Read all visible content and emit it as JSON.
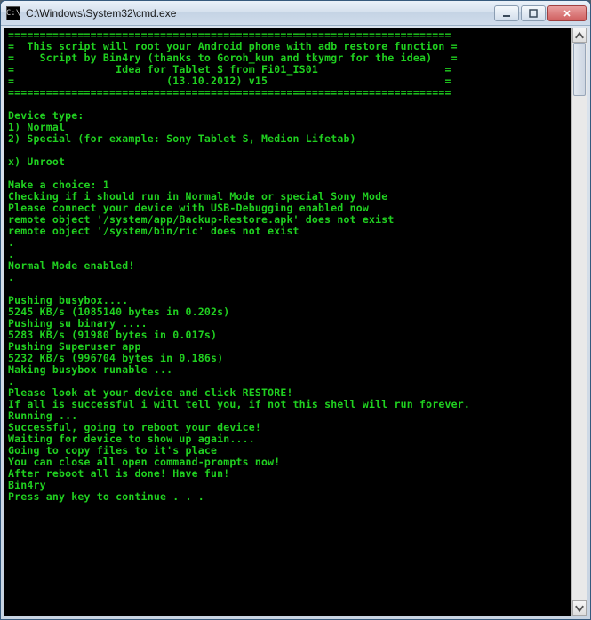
{
  "window": {
    "icon_glyph": "C:\\",
    "title": "C:\\Windows\\System32\\cmd.exe"
  },
  "console": {
    "lines": [
      "======================================================================",
      "=  This script will root your Android phone with adb restore function =",
      "=    Script by Bin4ry (thanks to Goroh_kun and tkymgr for the idea)   =",
      "=                Idea for Tablet S from Fi01_IS01                    =",
      "=                        (13.10.2012) v15                            =",
      "======================================================================",
      "",
      "Device type:",
      "1) Normal",
      "2) Special (for example: Sony Tablet S, Medion Lifetab)",
      "",
      "x) Unroot",
      "",
      "Make a choice: 1",
      "Checking if i should run in Normal Mode or special Sony Mode",
      "Please connect your device with USB-Debugging enabled now",
      "remote object '/system/app/Backup-Restore.apk' does not exist",
      "remote object '/system/bin/ric' does not exist",
      ".",
      ".",
      "Normal Mode enabled!",
      ".",
      "",
      "Pushing busybox....",
      "5245 KB/s (1085140 bytes in 0.202s)",
      "Pushing su binary ....",
      "5283 KB/s (91980 bytes in 0.017s)",
      "Pushing Superuser app",
      "5232 KB/s (996704 bytes in 0.186s)",
      "Making busybox runable ...",
      ".",
      "Please look at your device and click RESTORE!",
      "If all is successful i will tell you, if not this shell will run forever.",
      "Running ...",
      "Successful, going to reboot your device!",
      "Waiting for device to show up again....",
      "Going to copy files to it's place",
      "You can close all open command-prompts now!",
      "After reboot all is done! Have fun!",
      "Bin4ry",
      "Press any key to continue . . ."
    ]
  }
}
